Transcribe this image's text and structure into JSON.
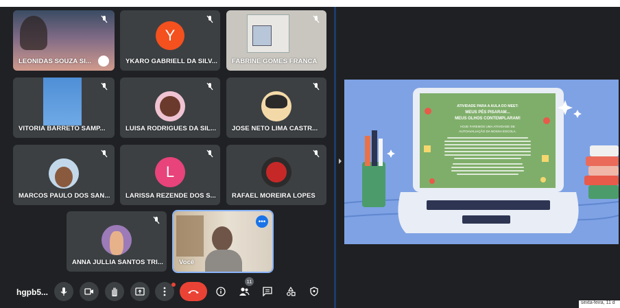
{
  "participants": [
    {
      "name": "LEONIDAS SOUZA SI...",
      "avatar_letter": "",
      "avatar_color": ""
    },
    {
      "name": "YKARO GABRIELL DA SILV...",
      "avatar_letter": "Y",
      "avatar_color": "#f4511e"
    },
    {
      "name": "FABRINE GOMES FRANCA",
      "avatar_letter": "",
      "avatar_color": ""
    },
    {
      "name": "VITORIA BARRETO SAMP...",
      "avatar_letter": "",
      "avatar_color": ""
    },
    {
      "name": "LUISA RODRIGUES DA SIL...",
      "avatar_letter": "",
      "avatar_color": ""
    },
    {
      "name": "JOSE NETO LIMA CASTR...",
      "avatar_letter": "",
      "avatar_color": ""
    },
    {
      "name": "MARCOS PAULO DOS SAN...",
      "avatar_letter": "",
      "avatar_color": ""
    },
    {
      "name": "LARISSA REZENDE DOS S...",
      "avatar_letter": "L",
      "avatar_color": "#e8437a"
    },
    {
      "name": "RAFAEL MOREIRA LOPES",
      "avatar_letter": "",
      "avatar_color": ""
    },
    {
      "name": "ANNA JULLIA SANTOS TRI...",
      "avatar_letter": "",
      "avatar_color": ""
    },
    {
      "name": "Você",
      "avatar_letter": "",
      "avatar_color": ""
    }
  ],
  "toolbar": {
    "meeting_code": "hgpb5...",
    "participants_count": "11"
  },
  "slide": {
    "line1": "ATIVIDADE PARA A AULA DO MEET:",
    "line2": "MEUS PÉS PISARAM...",
    "line3": "MEUS OLHOS CONTEMPLARAM!",
    "line4": "HOJE FAREMOS UMA ATIVIDADE DE",
    "line5": "AUTOAVALIAÇÃO DA NOSSA ESCOLA."
  },
  "taskbar": {
    "date_text": "sexta-feira, 11 d"
  },
  "colors": {
    "meet_bg": "#202124",
    "tile_bg": "#3c4043",
    "end_call": "#ea4335",
    "slide_bg": "#7ea2e4",
    "board_green": "#7fae6a"
  }
}
